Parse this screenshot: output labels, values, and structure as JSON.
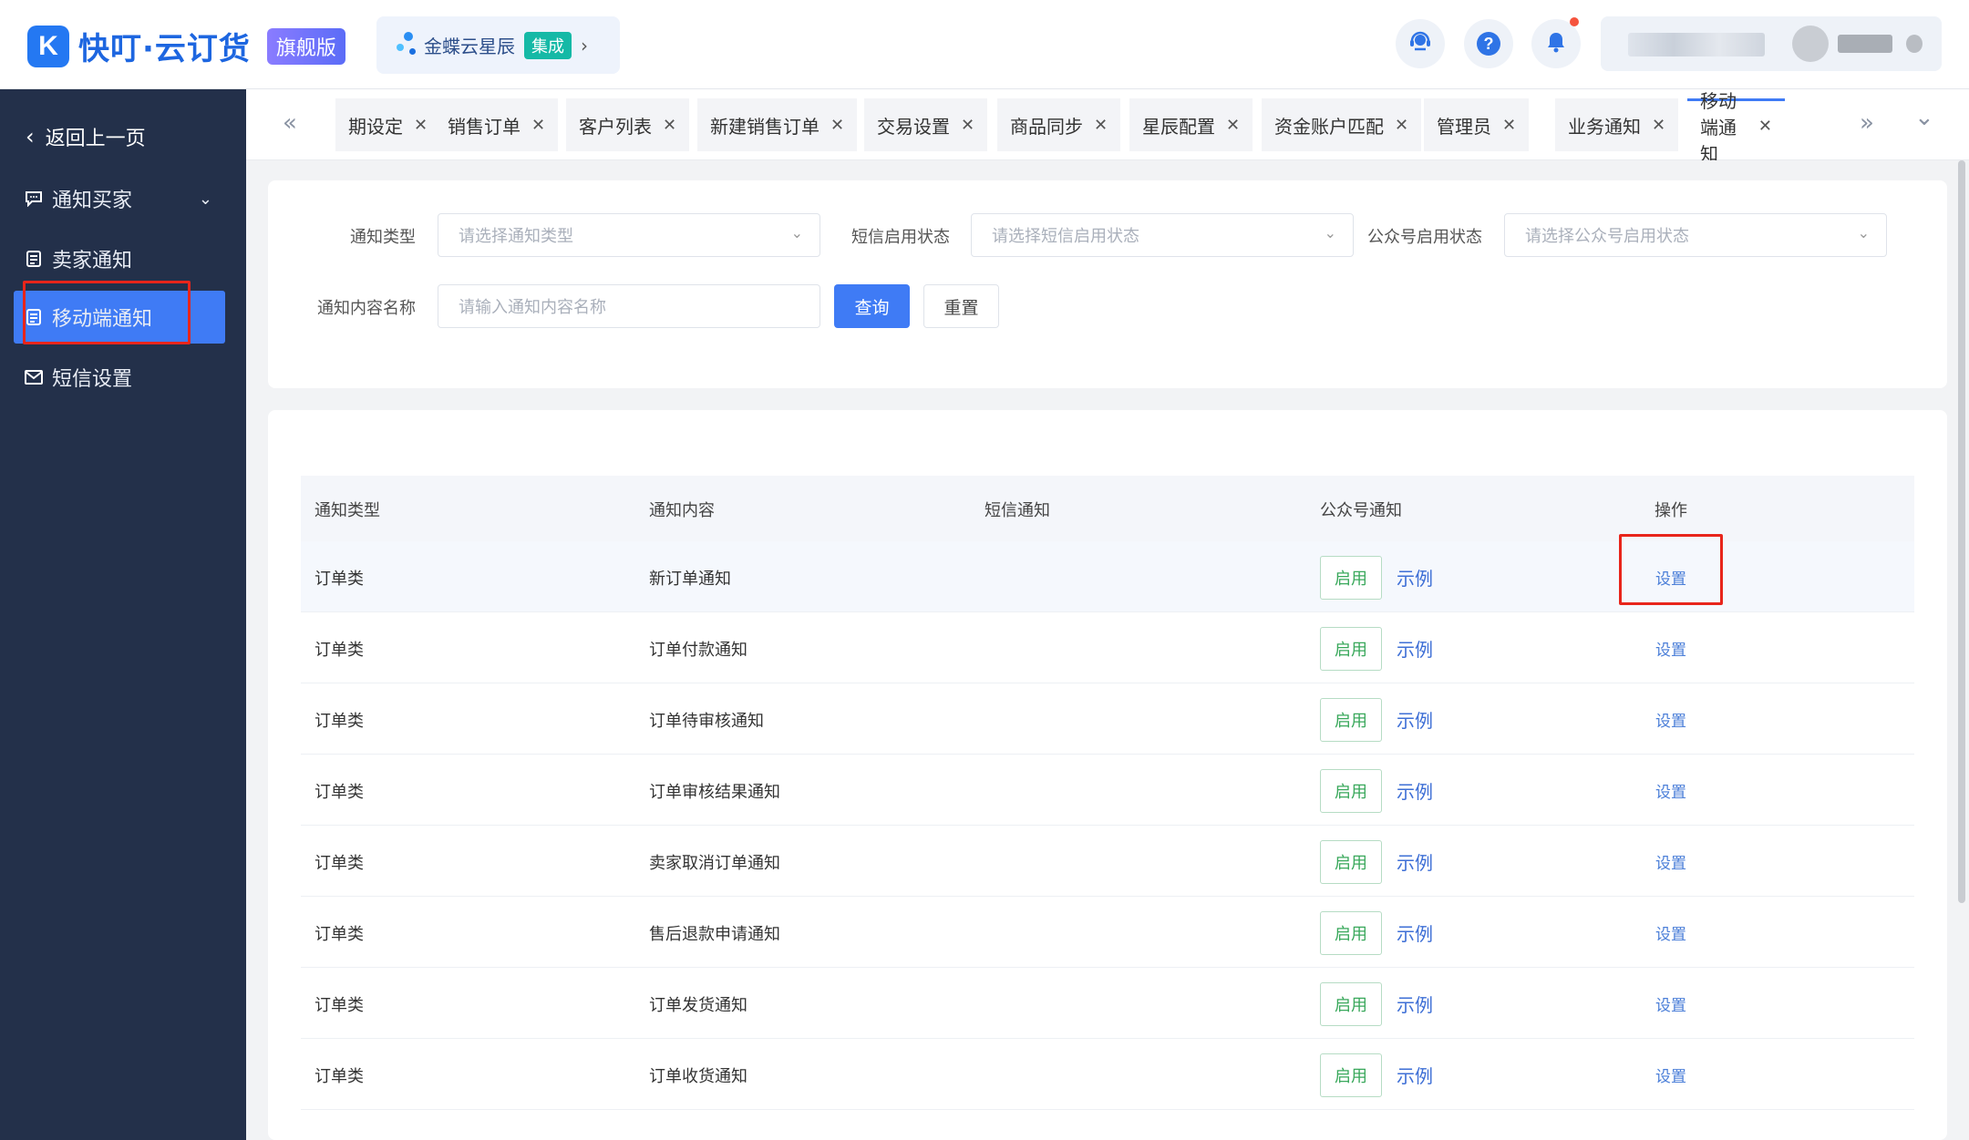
{
  "header": {
    "logo_mark": "K",
    "logo_text": "快叮·云订货",
    "edition_badge": "旗舰版",
    "integration": {
      "name": "金蝶云星辰",
      "tag": "集成",
      "chevron": "›"
    },
    "icons": [
      "headset-icon",
      "help-icon",
      "bell-icon"
    ],
    "help_glyph": "?"
  },
  "sidebar": {
    "back_label": "返回上一页",
    "items": [
      {
        "label": "通知买家",
        "icon": "chat-icon",
        "has_caret": true
      },
      {
        "label": "卖家通知",
        "icon": "doc-icon"
      },
      {
        "label": "移动端通知",
        "icon": "doc-icon",
        "active": true
      },
      {
        "label": "短信设置",
        "icon": "mail-icon"
      }
    ]
  },
  "tabs": {
    "prev_glyph": "«",
    "next_glyph": "»",
    "more_glyph": "⌄",
    "items": [
      {
        "label": "期设定"
      },
      {
        "label": "销售订单"
      },
      {
        "label": "客户列表"
      },
      {
        "label": "新建销售订单"
      },
      {
        "label": "交易设置"
      },
      {
        "label": "商品同步"
      },
      {
        "label": "星辰配置"
      },
      {
        "label": "资金账户匹配"
      },
      {
        "label": "管理员"
      },
      {
        "label": "业务通知"
      },
      {
        "label": "移动端通知",
        "active": true
      }
    ]
  },
  "filters": {
    "notice_type": {
      "label": "通知类型",
      "placeholder": "请选择通知类型"
    },
    "sms_status": {
      "label": "短信启用状态",
      "placeholder": "请选择短信启用状态"
    },
    "wechat_status": {
      "label": "公众号启用状态",
      "placeholder": "请选择公众号启用状态"
    },
    "content_name": {
      "label": "通知内容名称",
      "placeholder": "请输入通知内容名称"
    },
    "query_label": "查询",
    "reset_label": "重置"
  },
  "table": {
    "columns": [
      "通知类型",
      "通知内容",
      "短信通知",
      "公众号通知",
      "操作"
    ],
    "enable_label": "启用",
    "example_label": "示例",
    "action_label": "设置",
    "rows": [
      {
        "type": "订单类",
        "content": "新订单通知"
      },
      {
        "type": "订单类",
        "content": "订单付款通知"
      },
      {
        "type": "订单类",
        "content": "订单待审核通知"
      },
      {
        "type": "订单类",
        "content": "订单审核结果通知"
      },
      {
        "type": "订单类",
        "content": "卖家取消订单通知"
      },
      {
        "type": "订单类",
        "content": "售后退款申请通知"
      },
      {
        "type": "订单类",
        "content": "订单发货通知"
      },
      {
        "type": "订单类",
        "content": "订单收货通知"
      }
    ]
  },
  "colors": {
    "sidebar_bg": "#23304a",
    "primary": "#3f7bf5",
    "enable_green": "#39a85b",
    "highlight_red": "#e8251b"
  }
}
